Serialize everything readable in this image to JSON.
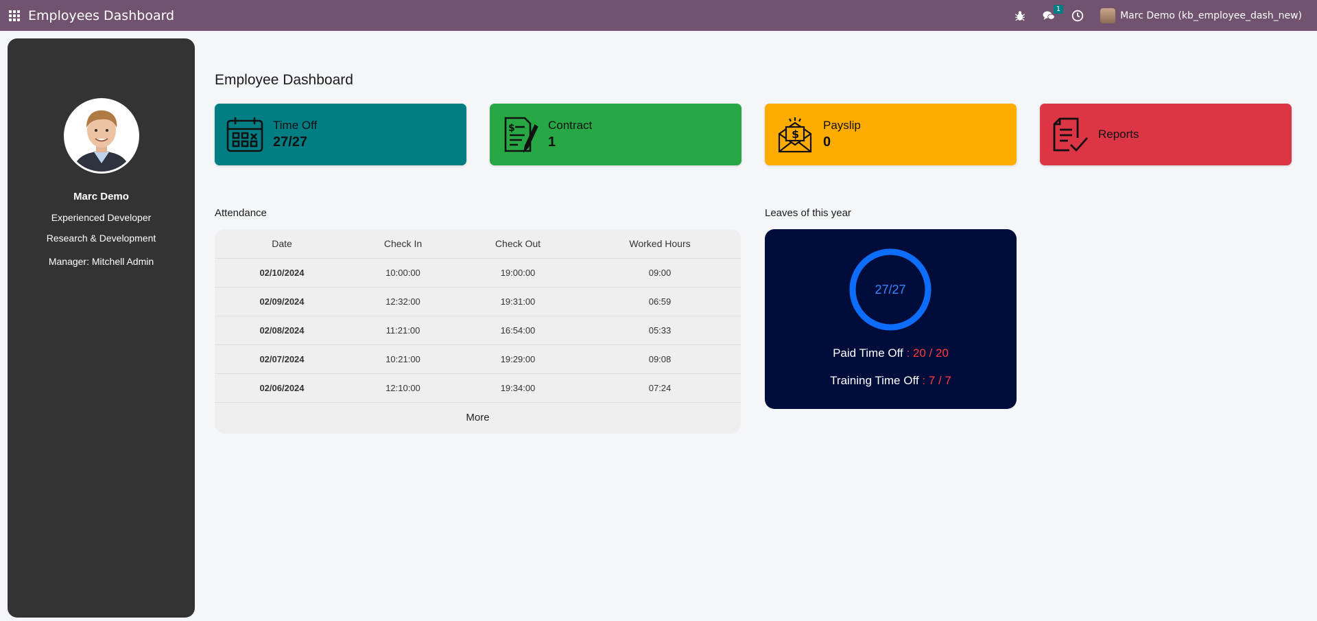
{
  "navbar": {
    "app_title": "Employees Dashboard",
    "message_count": "1",
    "user_name": "Marc Demo (kb_employee_dash_new)"
  },
  "profile": {
    "name": "Marc Demo",
    "job_title": "Experienced Developer",
    "department": "Research & Development",
    "manager": "Manager: Mitchell Admin"
  },
  "main": {
    "title": "Employee Dashboard"
  },
  "cards": {
    "timeoff": {
      "label": "Time Off",
      "value": "27/27"
    },
    "contract": {
      "label": "Contract",
      "value": "1"
    },
    "payslip": {
      "label": "Payslip",
      "value": "0"
    },
    "reports": {
      "label": "Reports"
    }
  },
  "attendance": {
    "title": "Attendance",
    "columns": [
      "Date",
      "Check In",
      "Check Out",
      "Worked Hours"
    ],
    "rows": [
      [
        "02/10/2024",
        "10:00:00",
        "19:00:00",
        "09:00"
      ],
      [
        "02/09/2024",
        "12:32:00",
        "19:31:00",
        "06:59"
      ],
      [
        "02/08/2024",
        "11:21:00",
        "16:54:00",
        "05:33"
      ],
      [
        "02/07/2024",
        "10:21:00",
        "19:29:00",
        "09:08"
      ],
      [
        "02/06/2024",
        "12:10:00",
        "19:34:00",
        "07:24"
      ]
    ],
    "more_label": "More"
  },
  "leaves": {
    "title": "Leaves of this year",
    "ring_label": "27/27",
    "ring_fraction": 1.0,
    "items": [
      {
        "label": "Paid Time Off",
        "value": " : 20 / 20"
      },
      {
        "label": "Training Time Off",
        "value": " : 7 / 7"
      }
    ]
  },
  "colors": {
    "navbar": "#71526f",
    "timeoff": "#017e84",
    "contract": "#28a745",
    "payslip": "#ffac00",
    "reports": "#dc3545",
    "leaves_bg": "#000d3b",
    "ring": "#0d6efd",
    "leave_value": "#ff3b3b"
  }
}
